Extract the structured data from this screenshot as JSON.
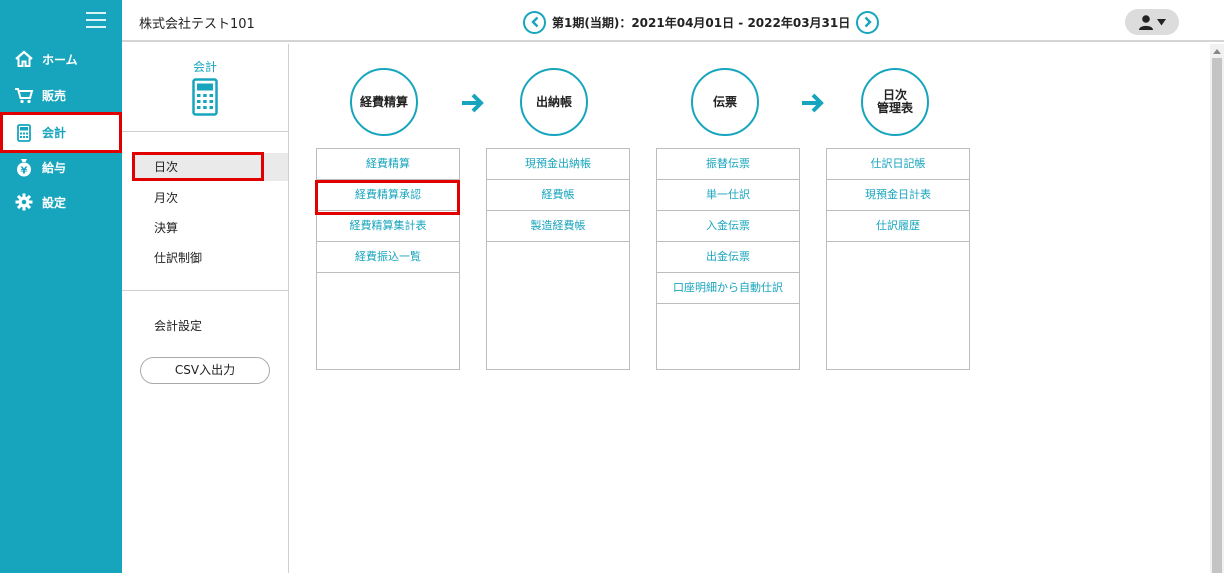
{
  "sidebar": {
    "items": [
      {
        "label": "ホーム",
        "icon": "home-icon"
      },
      {
        "label": "販売",
        "icon": "cart-icon"
      },
      {
        "label": "会計",
        "icon": "calculator-icon",
        "active": true
      },
      {
        "label": "給与",
        "icon": "money-bag-icon"
      },
      {
        "label": "設定",
        "icon": "gear-icon"
      }
    ]
  },
  "header": {
    "company": "株式会社テスト101",
    "period": "第1期(当期)：2021年04月01日 - 2022年03月31日"
  },
  "submenu": {
    "title": "会計",
    "items": [
      "日次",
      "月次",
      "決算",
      "仕訳制御"
    ],
    "active_index": 0,
    "settings": "会計設定",
    "csv_button": "CSV入出力"
  },
  "steps": [
    {
      "label": "経費精算"
    },
    {
      "label": "出納帳"
    },
    {
      "label": "伝票"
    },
    {
      "label_line1": "日次",
      "label_line2": "管理表"
    }
  ],
  "columns": [
    {
      "items": [
        "経費精算",
        "経費精算承認",
        "経費精算集計表",
        "経費振込一覧"
      ]
    },
    {
      "items": [
        "現預金出納帳",
        "経費帳",
        "製造経費帳"
      ]
    },
    {
      "items": [
        "振替伝票",
        "単一仕訳",
        "入金伝票",
        "出金伝票",
        "口座明細から自動仕訳"
      ]
    },
    {
      "items": [
        "仕訳日記帳",
        "現預金日計表",
        "仕訳履歴"
      ]
    }
  ],
  "colors": {
    "accent": "#17a5bd",
    "highlight": "#e00000"
  }
}
